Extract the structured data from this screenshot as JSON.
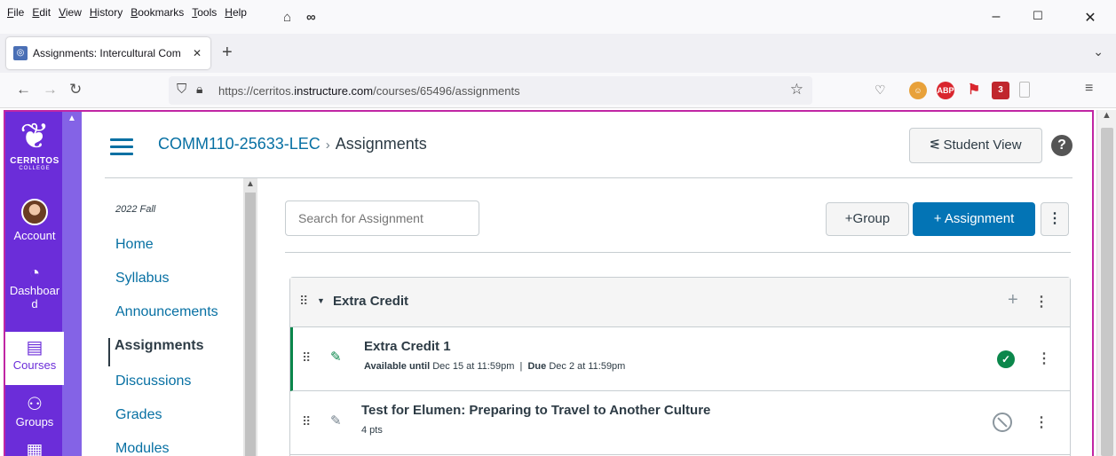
{
  "browser": {
    "menus": [
      "File",
      "Edit",
      "View",
      "History",
      "Bookmarks",
      "Tools",
      "Help"
    ],
    "tab_title": "Assignments: Intercultural Com",
    "url_prefix": "https://cerritos.",
    "url_domain": "instructure.com",
    "url_path": "/courses/65496/assignments",
    "extension_badge": "3",
    "abp_label": "ABP"
  },
  "global_nav": {
    "logo_name": "CERRITOS",
    "logo_sub": "COLLEGE",
    "items": [
      {
        "label": "Account",
        "icon": "avatar"
      },
      {
        "label": "Dashboard",
        "icon": "dashboard-icon"
      },
      {
        "label": "Courses",
        "icon": "courses-icon",
        "active": true
      },
      {
        "label": "Groups",
        "icon": "groups-icon"
      },
      {
        "label": "Calendar",
        "icon": "calendar-icon"
      }
    ],
    "dashboard_line1": "Dashboar",
    "dashboard_line2": "d"
  },
  "header": {
    "course": "COMM110-25633-LEC",
    "separator": "›",
    "current": "Assignments",
    "student_view": "Student View",
    "help": "?"
  },
  "course_nav": {
    "term": "2022 Fall",
    "links": [
      "Home",
      "Syllabus",
      "Announcements",
      "Assignments",
      "Discussions",
      "Grades",
      "Modules"
    ],
    "active": "Assignments"
  },
  "toolbar": {
    "search_placeholder": "Search for Assignment",
    "group_button": "+Group",
    "assignment_button": "+ Assignment"
  },
  "assignment_group": {
    "title": "Extra Credit",
    "assignments": [
      {
        "title": "Extra Credit 1",
        "available_label": "Available until",
        "available_value": "Dec 15 at 11:59pm",
        "divider": "|",
        "due_label": "Due",
        "due_value": "Dec 2 at 11:59pm",
        "published": true
      },
      {
        "title": "Test for Elumen: Preparing to Travel to Another Culture",
        "points": "4 pts",
        "published": false
      }
    ]
  },
  "colors": {
    "global_nav": "#6b2dd9",
    "link": "#0770a3",
    "primary_button": "#0374b5",
    "published": "#0b874b",
    "frame": "#c026a4"
  }
}
